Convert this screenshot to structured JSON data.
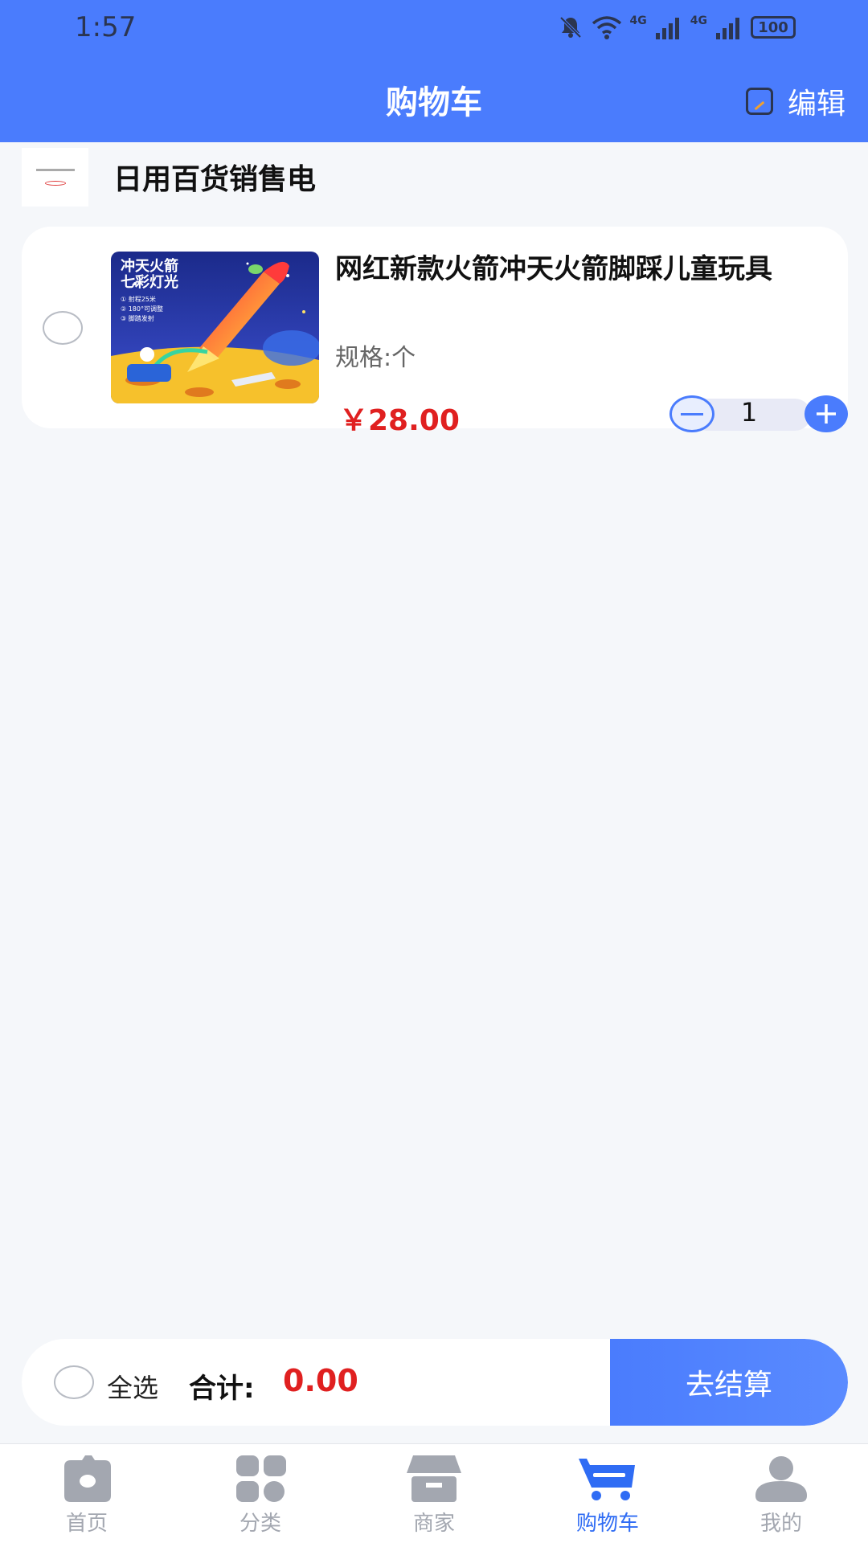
{
  "status_bar": {
    "time": "1:57",
    "network_1": "4G",
    "network_2": "4G",
    "battery": "100"
  },
  "header": {
    "title": "购物车",
    "edit_label": "编辑"
  },
  "shop": {
    "name": "日用百货销售电"
  },
  "cart_item": {
    "title": "网红新款火箭冲天火箭脚踩儿童玩具",
    "spec": "规格:个",
    "price": "￥28.00",
    "quantity": "1"
  },
  "checkout": {
    "select_all_label": "全选",
    "total_label": "合计:",
    "total_value": "0.00",
    "checkout_label": "去结算"
  },
  "tabs": [
    {
      "label": "首页",
      "icon": "home-icon"
    },
    {
      "label": "分类",
      "icon": "category-icon"
    },
    {
      "label": "商家",
      "icon": "store-icon"
    },
    {
      "label": "购物车",
      "icon": "cart-icon",
      "active": true
    },
    {
      "label": "我的",
      "icon": "profile-icon"
    }
  ],
  "colors": {
    "primary": "#4a7cfd",
    "price_red": "#e02020",
    "tab_inactive": "#a3a7b0",
    "page_bg": "#f5f7fa"
  }
}
